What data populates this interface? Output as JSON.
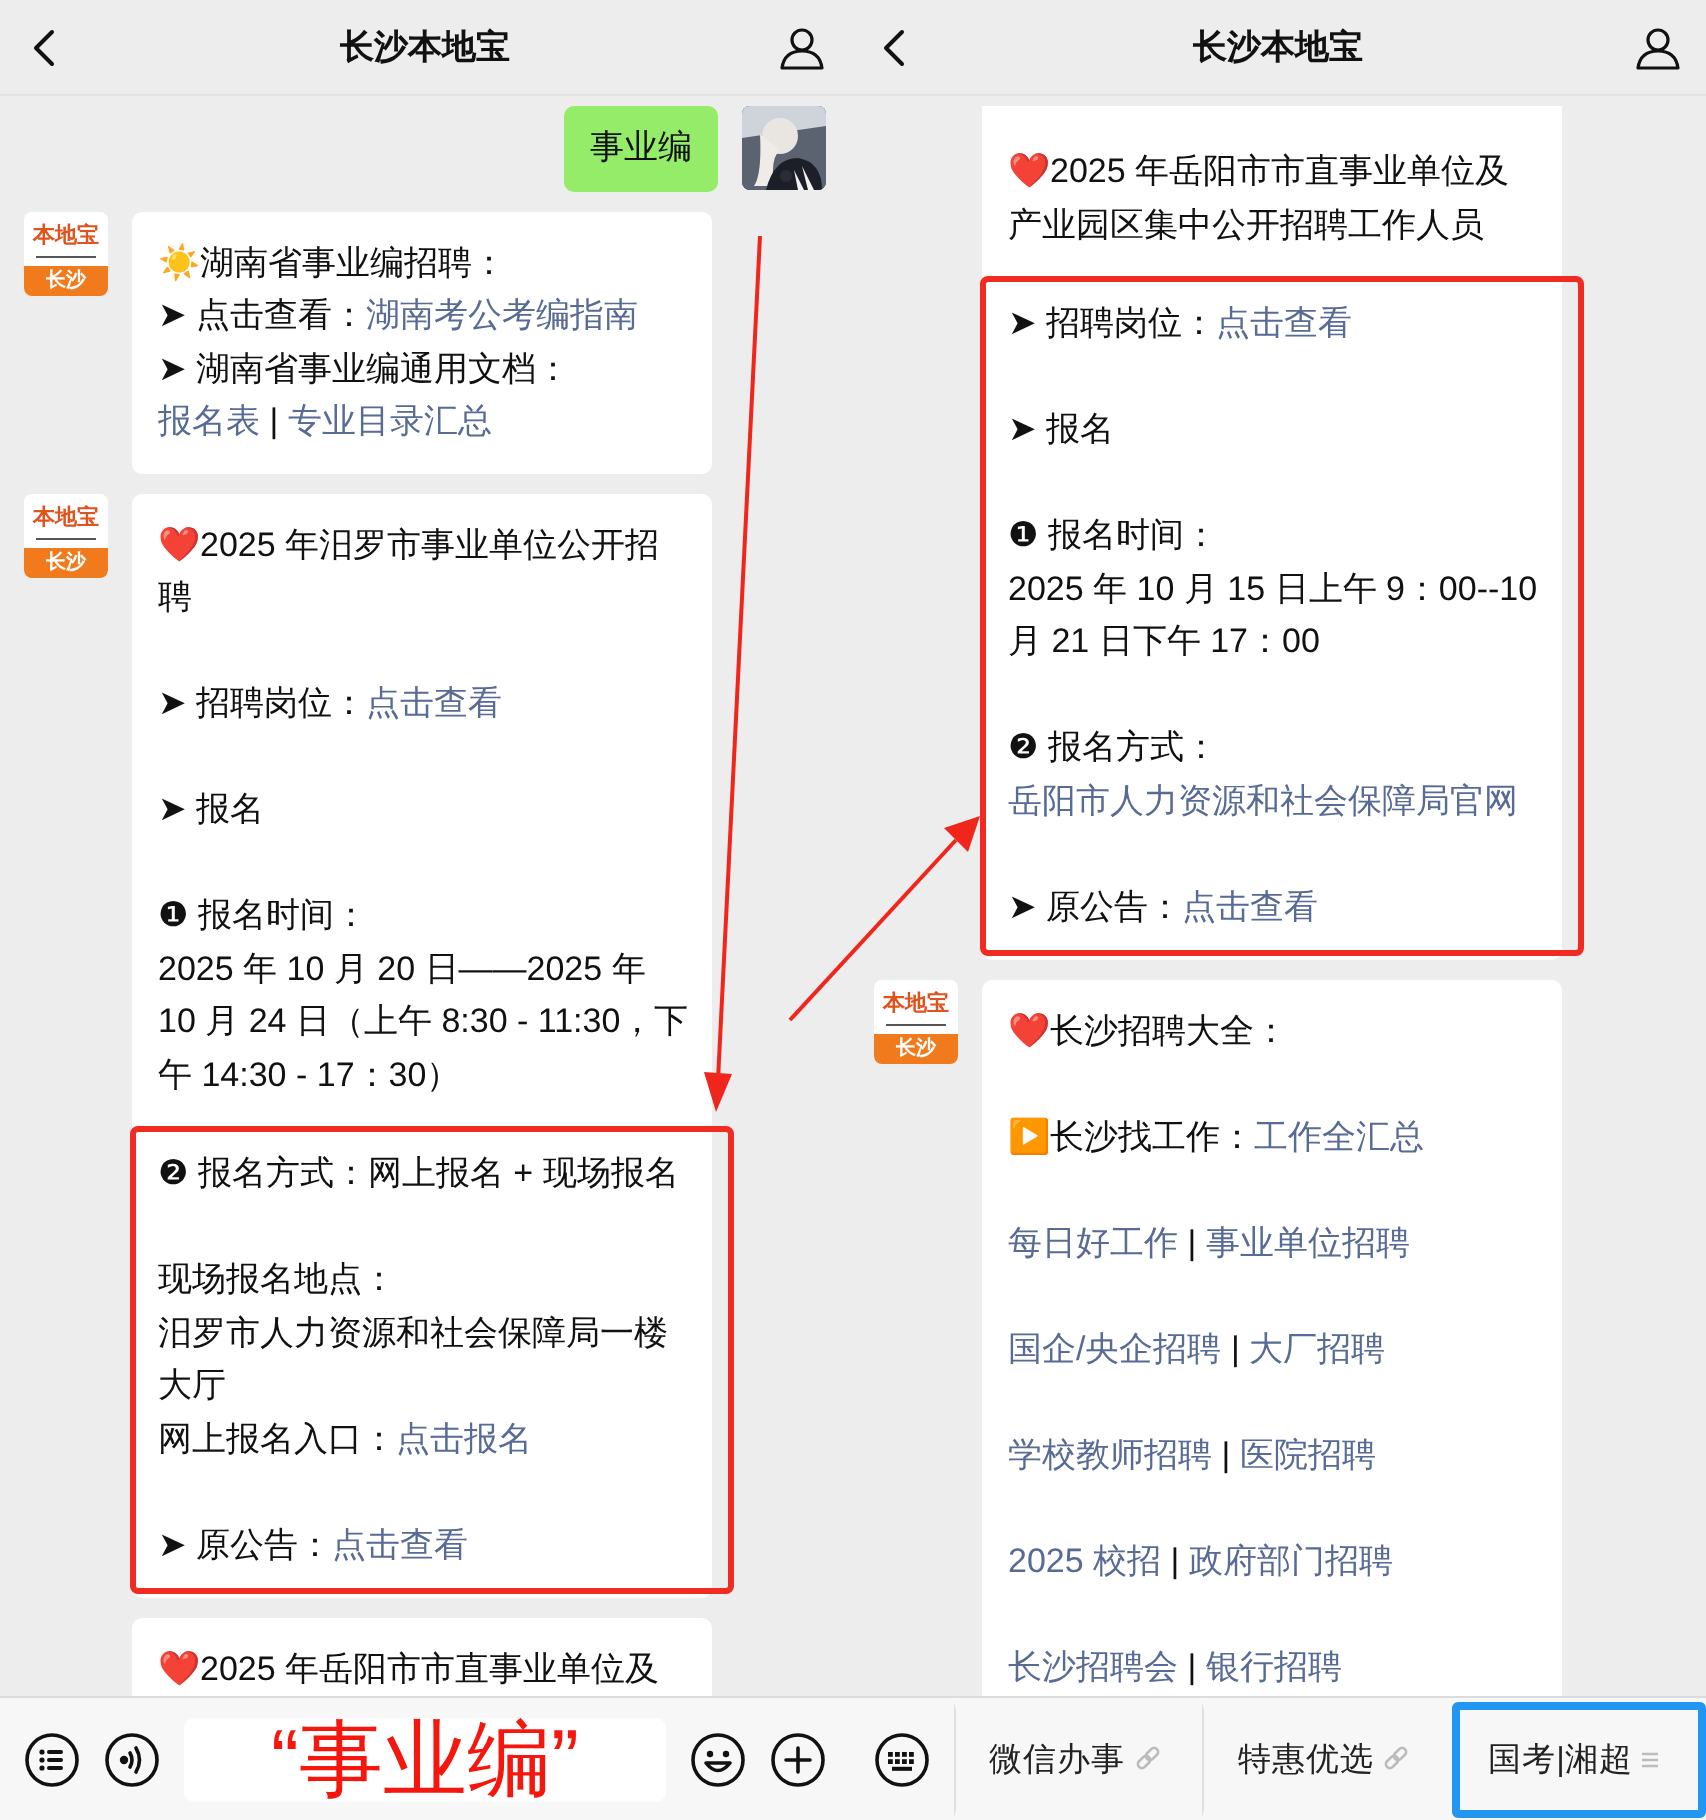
{
  "panels": [
    {
      "header": {
        "title": "长沙本地宝"
      },
      "messages": [
        {
          "outgoing": true,
          "continued": false,
          "avatar": {
            "kind": "picture"
          },
          "paragraphs": [
            {
              "kind": "para",
              "lines": [
                [
                  {
                    "kind": "text",
                    "text": "事业编"
                  }
                ]
              ]
            }
          ]
        },
        {
          "outgoing": false,
          "continued": false,
          "avatar": {
            "kind": "logo",
            "brand": "本地宝",
            "city": "长沙"
          },
          "paragraphs": [
            {
              "kind": "para",
              "lines": [
                [
                  {
                    "kind": "text",
                    "text": "☀️湖南省事业编招聘："
                  }
                ],
                [
                  {
                    "kind": "text",
                    "text": "➤ 点击查看："
                  },
                  {
                    "kind": "link",
                    "text": "湖南考公考编指南"
                  }
                ],
                [
                  {
                    "kind": "text",
                    "text": "➤ 湖南省事业编通用文档："
                  }
                ],
                [
                  {
                    "kind": "link",
                    "text": "报名表"
                  },
                  {
                    "kind": "text",
                    "text": " | "
                  },
                  {
                    "kind": "link",
                    "text": "专业目录汇总"
                  }
                ]
              ]
            }
          ]
        },
        {
          "outgoing": false,
          "continued": false,
          "avatar": {
            "kind": "logo",
            "brand": "本地宝",
            "city": "长沙"
          },
          "paragraphs": [
            {
              "kind": "para",
              "lines": [
                [
                  {
                    "kind": "text",
                    "text": "❤️2025 年汨罗市事业单位公开招聘"
                  }
                ]
              ]
            },
            {
              "kind": "para",
              "lines": [
                [
                  {
                    "kind": "text",
                    "text": "➤ 招聘岗位："
                  },
                  {
                    "kind": "link",
                    "text": "点击查看"
                  }
                ]
              ]
            },
            {
              "kind": "para",
              "lines": [
                [
                  {
                    "kind": "text",
                    "text": "➤ 报名"
                  }
                ]
              ]
            },
            {
              "kind": "para",
              "lines": [
                [
                  {
                    "kind": "text",
                    "text": "❶ 报名时间："
                  }
                ],
                [
                  {
                    "kind": "text",
                    "text": "2025 年 10 月 20 日——2025 年 10 月 24 日（上午 8:30 - 11:30，下午 14:30 - 17：30）"
                  }
                ]
              ]
            },
            {
              "kind": "highlight",
              "paragraphs": [
                {
                  "kind": "para",
                  "lines": [
                    [
                      {
                        "kind": "text",
                        "text": "❷ 报名方式：网上报名 + 现场报名"
                      }
                    ]
                  ]
                },
                {
                  "kind": "para",
                  "lines": [
                    [
                      {
                        "kind": "text",
                        "text": "现场报名地点："
                      }
                    ],
                    [
                      {
                        "kind": "text",
                        "text": "汨罗市人力资源和社会保障局一楼大厅"
                      }
                    ],
                    [
                      {
                        "kind": "text",
                        "text": "网上报名入口："
                      },
                      {
                        "kind": "link",
                        "text": "点击报名"
                      }
                    ]
                  ]
                },
                {
                  "kind": "para",
                  "lines": [
                    [
                      {
                        "kind": "text",
                        "text": "➤ 原公告："
                      },
                      {
                        "kind": "link",
                        "text": "点击查看"
                      }
                    ]
                  ]
                }
              ]
            }
          ]
        },
        {
          "outgoing": false,
          "continued": false,
          "avatar": {
            "kind": "none"
          },
          "paragraphs": [
            {
              "kind": "para",
              "lines": [
                [
                  {
                    "kind": "text",
                    "text": "❤️2025 年岳阳市市直事业单位及"
                  }
                ]
              ]
            }
          ]
        }
      ],
      "bottom_bar": {
        "kind": "input",
        "annotation": "“事业编”"
      }
    },
    {
      "header": {
        "title": "长沙本地宝"
      },
      "messages": [
        {
          "outgoing": false,
          "continued": true,
          "avatar": {
            "kind": "none"
          },
          "paragraphs": [
            {
              "kind": "para",
              "lines": [
                [
                  {
                    "kind": "text",
                    "text": "❤️2025 年岳阳市市直事业单位及产业园区集中公开招聘工作人员"
                  }
                ]
              ]
            },
            {
              "kind": "highlight",
              "paragraphs": [
                {
                  "kind": "para",
                  "lines": [
                    [
                      {
                        "kind": "text",
                        "text": "➤ 招聘岗位："
                      },
                      {
                        "kind": "link",
                        "text": "点击查看"
                      }
                    ]
                  ]
                },
                {
                  "kind": "para",
                  "lines": [
                    [
                      {
                        "kind": "text",
                        "text": "➤ 报名"
                      }
                    ]
                  ]
                },
                {
                  "kind": "para",
                  "lines": [
                    [
                      {
                        "kind": "text",
                        "text": "❶ 报名时间："
                      }
                    ],
                    [
                      {
                        "kind": "text",
                        "text": "2025 年 10 月 15 日上午 9：00--10 月 21 日下午 17：00"
                      }
                    ]
                  ]
                },
                {
                  "kind": "para",
                  "lines": [
                    [
                      {
                        "kind": "text",
                        "text": "❷ 报名方式："
                      }
                    ],
                    [
                      {
                        "kind": "link",
                        "text": "岳阳市人力资源和社会保障局官网"
                      }
                    ]
                  ]
                },
                {
                  "kind": "para",
                  "lines": [
                    [
                      {
                        "kind": "text",
                        "text": "➤ 原公告："
                      },
                      {
                        "kind": "link",
                        "text": "点击查看"
                      }
                    ]
                  ]
                }
              ]
            }
          ]
        },
        {
          "outgoing": false,
          "continued": false,
          "avatar": {
            "kind": "logo",
            "brand": "本地宝",
            "city": "长沙"
          },
          "paragraphs": [
            {
              "kind": "para",
              "lines": [
                [
                  {
                    "kind": "text",
                    "text": "❤️长沙招聘大全："
                  }
                ]
              ]
            },
            {
              "kind": "para",
              "lines": [
                [
                  {
                    "kind": "text",
                    "text": "▶️长沙找工作："
                  },
                  {
                    "kind": "link",
                    "text": "工作全汇总"
                  }
                ]
              ]
            },
            {
              "kind": "para",
              "lines": [
                [
                  {
                    "kind": "link",
                    "text": "每日好工作"
                  },
                  {
                    "kind": "text",
                    "text": " | "
                  },
                  {
                    "kind": "link",
                    "text": "事业单位招聘"
                  }
                ]
              ]
            },
            {
              "kind": "para",
              "lines": [
                [
                  {
                    "kind": "link",
                    "text": "国企/央企招聘"
                  },
                  {
                    "kind": "text",
                    "text": " | "
                  },
                  {
                    "kind": "link",
                    "text": "大厂招聘"
                  }
                ]
              ]
            },
            {
              "kind": "para",
              "lines": [
                [
                  {
                    "kind": "link",
                    "text": "学校教师招聘"
                  },
                  {
                    "kind": "text",
                    "text": " | "
                  },
                  {
                    "kind": "link",
                    "text": "医院招聘"
                  }
                ]
              ]
            },
            {
              "kind": "para",
              "lines": [
                [
                  {
                    "kind": "link",
                    "text": "2025 校招"
                  },
                  {
                    "kind": "text",
                    "text": " | "
                  },
                  {
                    "kind": "link",
                    "text": "政府部门招聘"
                  }
                ]
              ]
            },
            {
              "kind": "para",
              "lines": [
                [
                  {
                    "kind": "link",
                    "text": "长沙招聘会"
                  },
                  {
                    "kind": "text",
                    "text": " | "
                  },
                  {
                    "kind": "link",
                    "text": "银行招聘"
                  }
                ]
              ]
            }
          ]
        }
      ],
      "bottom_bar": {
        "kind": "menu",
        "items": [
          {
            "label": "微信办事",
            "kind": "link",
            "highlighted": false
          },
          {
            "label": "特惠优选",
            "kind": "link",
            "highlighted": false
          },
          {
            "label": "国考|湘超",
            "kind": "submenu",
            "highlighted": true
          }
        ]
      }
    }
  ]
}
